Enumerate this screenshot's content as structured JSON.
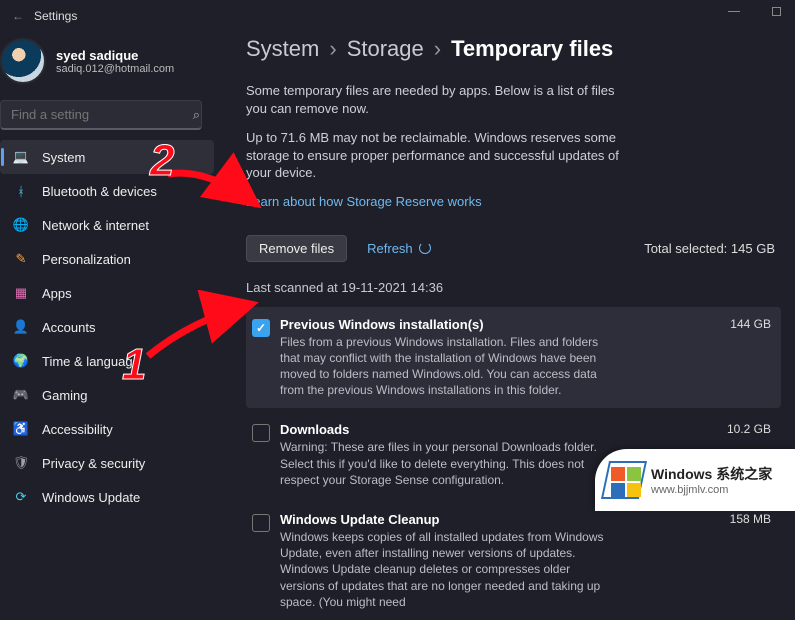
{
  "titlebar": {
    "title": "Settings"
  },
  "profile": {
    "name": "syed sadique",
    "email": "sadiq.012@hotmail.com"
  },
  "search": {
    "placeholder": "Find a setting"
  },
  "sidebar": {
    "items": [
      {
        "label": "System",
        "icon": "💻"
      },
      {
        "label": "Bluetooth & devices",
        "icon": "ᚼ"
      },
      {
        "label": "Network & internet",
        "icon": "🌐"
      },
      {
        "label": "Personalization",
        "icon": "✎"
      },
      {
        "label": "Apps",
        "icon": "▦"
      },
      {
        "label": "Accounts",
        "icon": "👤"
      },
      {
        "label": "Time & language",
        "icon": "🌍"
      },
      {
        "label": "Gaming",
        "icon": "🎮"
      },
      {
        "label": "Accessibility",
        "icon": "♿"
      },
      {
        "label": "Privacy & security",
        "icon": "🛡"
      },
      {
        "label": "Windows Update",
        "icon": "⟳"
      }
    ]
  },
  "breadcrumb": {
    "a": "System",
    "b": "Storage",
    "c": "Temporary files"
  },
  "intro": {
    "line1": "Some temporary files are needed by apps. Below is a list of files you can remove now.",
    "line2": "Up to 71.6 MB may not be reclaimable. Windows reserves some storage to ensure proper performance and successful updates of your device.",
    "link": "Learn about how Storage Reserve works"
  },
  "actions": {
    "remove": "Remove files",
    "refresh": "Refresh",
    "total": "Total selected: 145 GB"
  },
  "last_scanned": "Last scanned at 19-11-2021 14:36",
  "items": [
    {
      "checked": true,
      "title": "Previous Windows installation(s)",
      "size": "144 GB",
      "desc": "Files from a previous Windows installation.  Files and folders that may conflict with the installation of Windows have been moved to folders named Windows.old.  You can access data from the previous Windows installations in this folder."
    },
    {
      "checked": false,
      "title": "Downloads",
      "size": "10.2 GB",
      "desc": "Warning: These are files in your personal Downloads folder. Select this if you'd like to delete everything. This does not respect your Storage Sense configuration."
    },
    {
      "checked": false,
      "title": "Windows Update Cleanup",
      "size": "158 MB",
      "desc": "Windows keeps copies of all installed updates from Windows Update, even after installing newer versions of updates. Windows Update cleanup deletes or compresses older versions of updates that are no longer needed and taking up space. (You might need"
    }
  ],
  "annotations": {
    "n1": "1",
    "n2": "2"
  },
  "watermark": {
    "brand": "Windows",
    "suffix": "系统之家",
    "url": "www.bjjmlv.com"
  }
}
